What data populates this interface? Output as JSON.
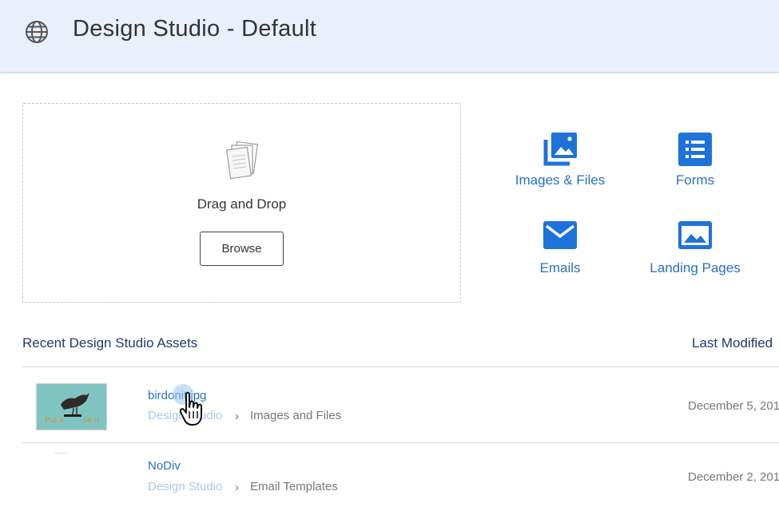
{
  "header": {
    "icon": "globe-icon",
    "title": "Design Studio - Default"
  },
  "dropzone": {
    "icon": "documents-icon",
    "label": "Drag and Drop",
    "browse_label": "Browse"
  },
  "tiles": [
    {
      "label": "Images & Files",
      "icon": "images-files-icon"
    },
    {
      "label": "Forms",
      "icon": "forms-icon"
    },
    {
      "label": "Emails",
      "icon": "email-icon"
    },
    {
      "label": "Landing Pages",
      "icon": "landing-page-icon"
    }
  ],
  "recent": {
    "title": "Recent Design Studio Assets",
    "last_modified_header": "Last Modified",
    "rows": [
      {
        "name": "birdonit.jpg",
        "crumb_root": "Design Studio",
        "crumb_sep": "›",
        "crumb_leaf": "Images and Files",
        "date": "December 5, 201"
      },
      {
        "name": "NoDiv",
        "crumb_root": "Design Studio",
        "crumb_sep": "›",
        "crumb_leaf": "Email Templates",
        "date": "December 2, 201"
      }
    ]
  },
  "colors": {
    "accent": "#2970c4",
    "icon_blue": "#1e73d9",
    "header_bg": "#e8f0fa",
    "section_title": "#213b6b"
  }
}
